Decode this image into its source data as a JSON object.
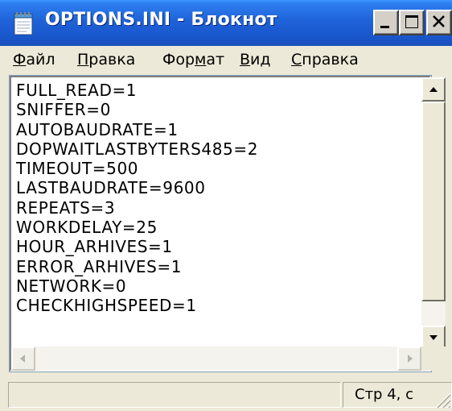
{
  "window": {
    "title": "OPTIONS.INI - Блокнот"
  },
  "menu": {
    "items": [
      {
        "prefix": "",
        "underlined": "Ф",
        "suffix": "айл"
      },
      {
        "prefix": "",
        "underlined": "П",
        "suffix": "равка"
      },
      {
        "prefix": "Фор",
        "underlined": "м",
        "suffix": "ат"
      },
      {
        "prefix": "",
        "underlined": "В",
        "suffix": "ид"
      },
      {
        "prefix": "",
        "underlined": "С",
        "suffix": "правка"
      }
    ]
  },
  "editor": {
    "lines": [
      "FULL_READ=1",
      "SNIFFER=0",
      "AUTOBAUDRATE=1",
      "DOPWAITLASTBYTERS485=2",
      "TIMEOUT=500",
      "LASTBAUDRATE=9600",
      "REPEATS=3",
      "WORKDELAY=25",
      "HOUR_ARHIVES=1",
      "ERROR_ARHIVES=1",
      "NETWORK=0",
      "CHECKHIGHSPEED=1"
    ]
  },
  "status": {
    "left_text": "",
    "position": "Стр 4, с"
  },
  "icons": {
    "app": "notepad-icon",
    "minimize": "minimize-icon",
    "maximize": "maximize-icon",
    "close": "close-icon"
  },
  "colors": {
    "titlebar": "#1f62d8",
    "chrome": "#ece9d8"
  }
}
